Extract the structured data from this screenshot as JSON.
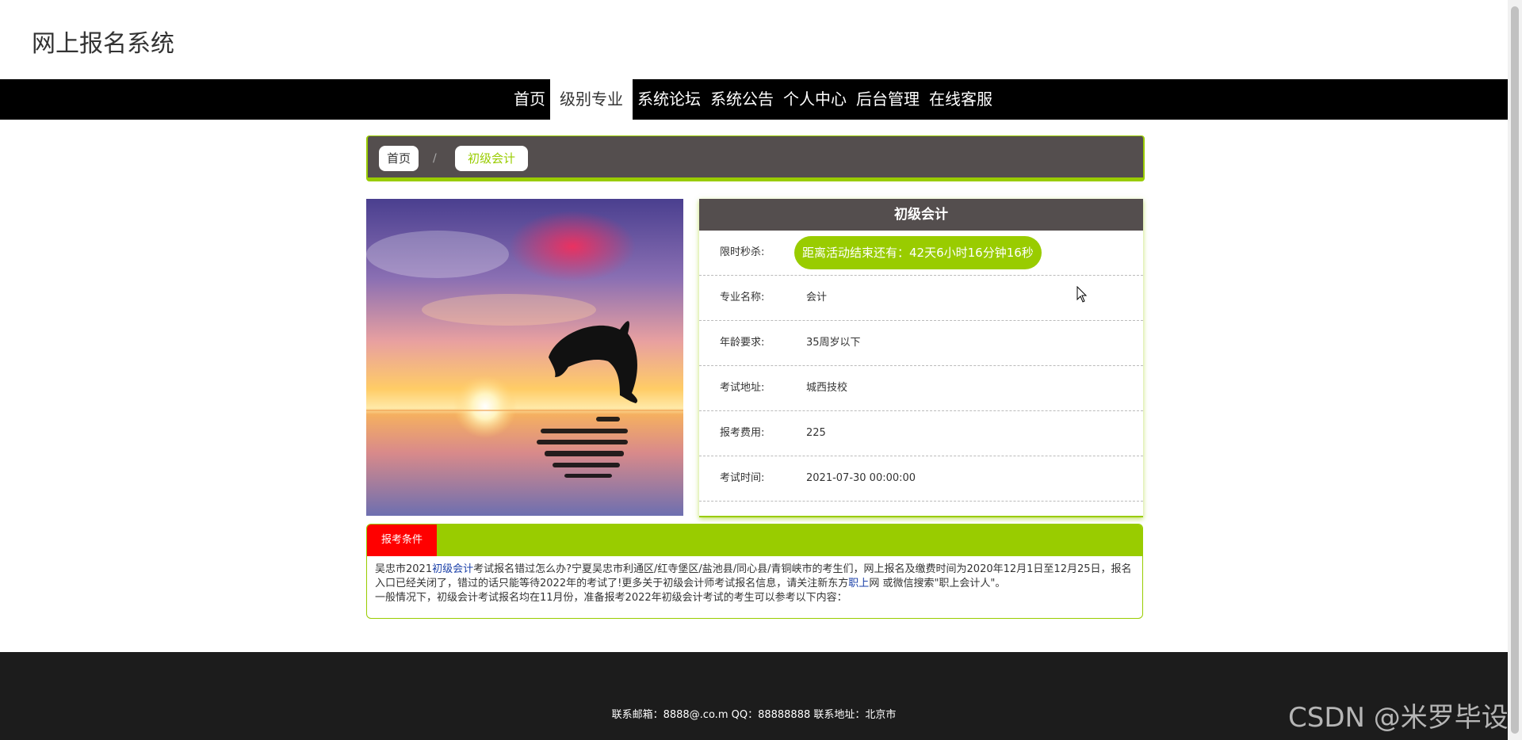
{
  "site": {
    "title": "网上报名系统"
  },
  "nav": {
    "items": [
      "首页",
      "级别专业",
      "系统论坛",
      "系统公告",
      "个人中心",
      "后台管理",
      "在线客服"
    ],
    "active_index": 1
  },
  "breadcrumb": {
    "home": "首页",
    "separator": "/",
    "current": "初级会计"
  },
  "detail": {
    "title": "初级会计",
    "rows": [
      {
        "label": "限时秒杀:",
        "value": "距离活动结束还有：42天6小时16分钟16秒",
        "badge": true
      },
      {
        "label": "专业名称:",
        "value": "会计"
      },
      {
        "label": "年龄要求:",
        "value": "35周岁以下"
      },
      {
        "label": "考试地址:",
        "value": "城西技校"
      },
      {
        "label": "报考费用:",
        "value": "225"
      },
      {
        "label": "考试时间:",
        "value": "2021-07-30 00:00:00"
      }
    ]
  },
  "tabs": {
    "active_label": "报考条件",
    "content": {
      "p1_a": "吴忠市2021",
      "p1_link": "初级会计",
      "p1_b": "考试报名错过怎么办?宁夏吴忠市利通区/红寺堡区/盐池县/同心县/青铜峡市的考生们，网上报名及缴费时间为2020年12月1日至12月25日，报名入口已经关闭了，错过的话只能等待2022年的考试了!更多关于初级会计师考试报名信息，请关注新东方",
      "p1_link2": "职上",
      "p1_c": "网 或微信搜索\"职上会计人\"。",
      "p2": "一般情况下，初级会计考试报名均在11月份，准备报考2022年初级会计考试的考生可以参考以下内容："
    }
  },
  "footer": {
    "text": "联系邮箱：8888@.co.m QQ：88888888 联系地址：北京市"
  },
  "watermark": "CSDN @米罗毕设",
  "colors": {
    "accent": "#99cc00",
    "dark": "#544e4e",
    "tab_active": "#ff0000",
    "nav_bg": "#000000",
    "footer_bg": "#1c1c1c"
  }
}
